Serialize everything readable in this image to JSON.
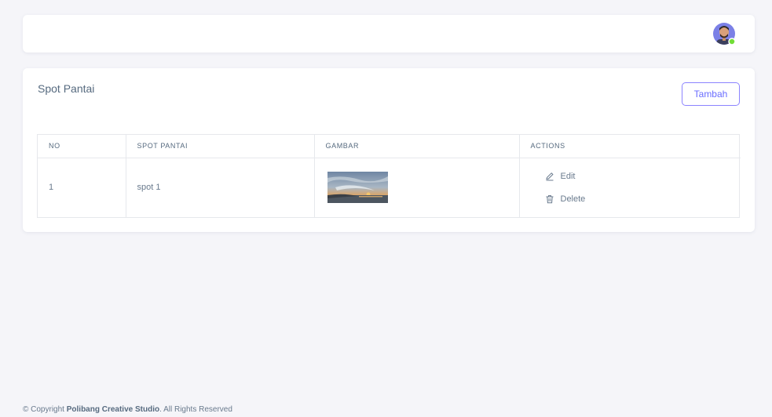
{
  "navbar": {
    "avatar_icon": "user-avatar",
    "status_color": "#71dd37"
  },
  "card": {
    "title": "Spot Pantai",
    "add_button": "Tambah",
    "accent": "#696cff"
  },
  "table": {
    "headers": [
      "NO",
      "SPOT PANTAI",
      "GAMBAR",
      "ACTIONS"
    ],
    "rows": [
      {
        "no": "1",
        "name": "spot 1",
        "image_icon": "beach-sunset-thumbnail"
      }
    ],
    "actions": {
      "edit": "Edit",
      "delete": "Delete"
    }
  },
  "footer": {
    "prefix": "© Copyright ",
    "brand": "Polibang Creative Studio",
    "suffix": ". All Rights Reserved"
  }
}
